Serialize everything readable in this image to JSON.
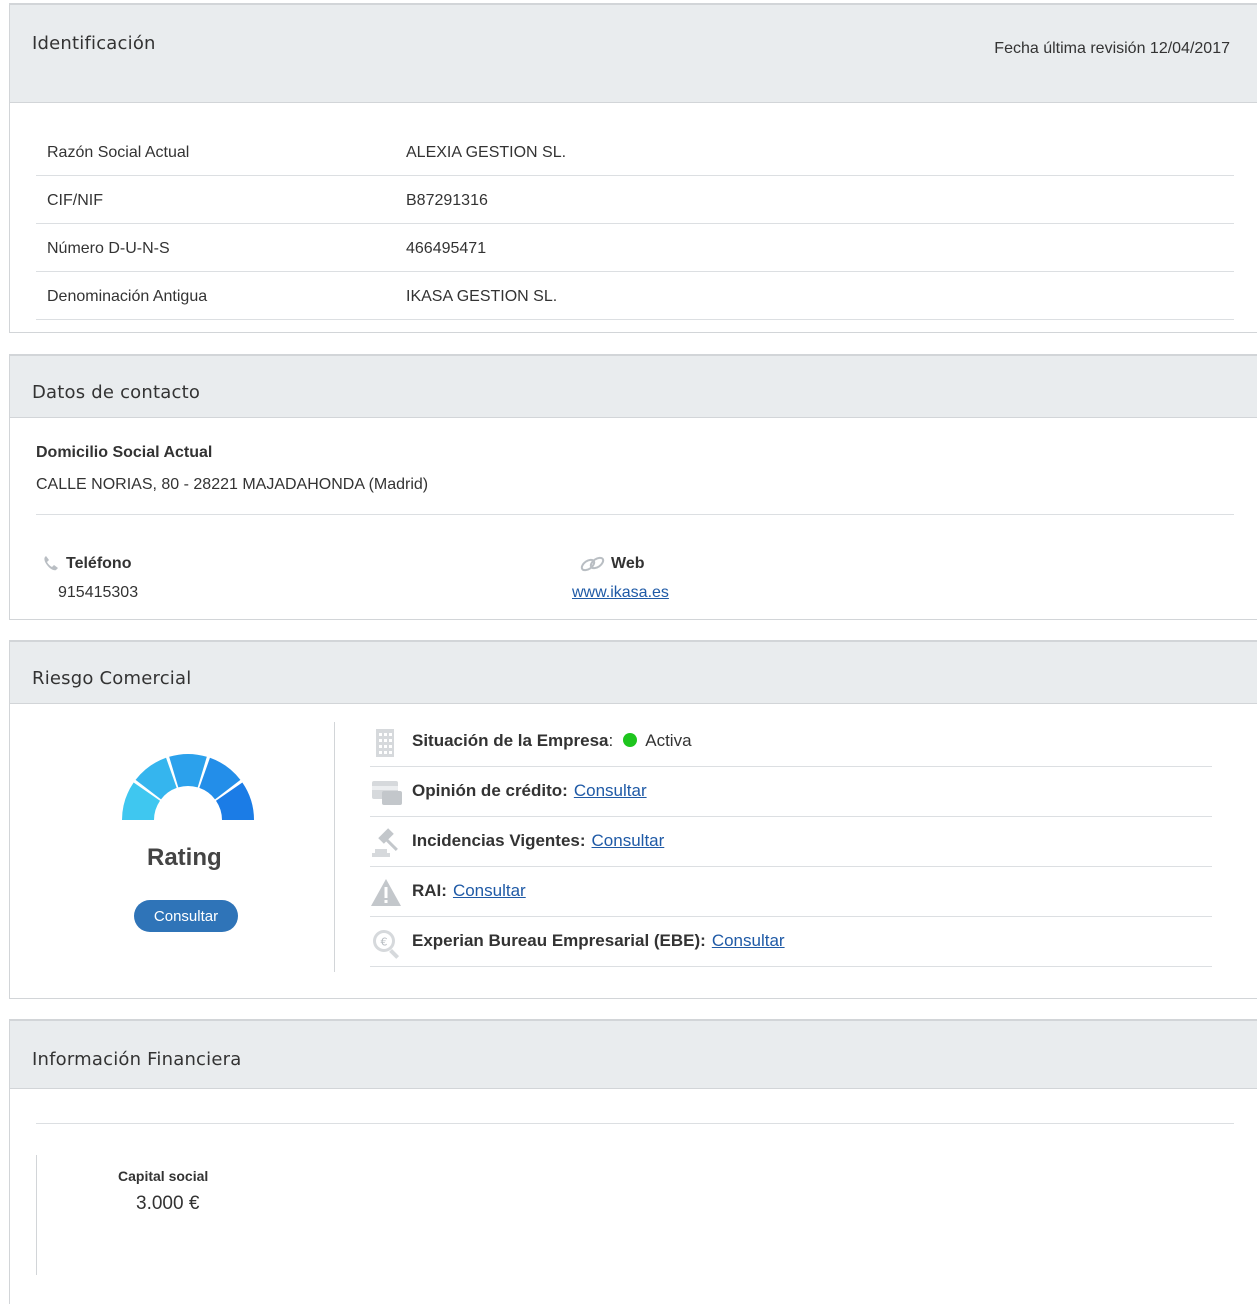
{
  "identificacion": {
    "title": "Identificación",
    "revision": "Fecha última revisión 12/04/2017",
    "rows": [
      {
        "label": "Razón Social Actual",
        "value": "ALEXIA GESTION SL."
      },
      {
        "label": "CIF/NIF",
        "value": "B87291316"
      },
      {
        "label": "Número D-U-N-S",
        "value": "466495471"
      },
      {
        "label": "Denominación Antigua",
        "value": "IKASA GESTION SL."
      }
    ]
  },
  "contacto": {
    "title": "Datos de contacto",
    "domicilio_label": "Domicilio Social Actual",
    "domicilio_value": "CALLE NORIAS, 80 - 28221 MAJADAHONDA (Madrid)",
    "telefono_label": "Teléfono",
    "telefono_value": "915415303",
    "web_label": "Web",
    "web_value": "www.ikasa.es"
  },
  "riesgo": {
    "title": "Riesgo Comercial",
    "rating_label": "Rating",
    "rating_button": "Consultar",
    "gauge_colors": [
      "#3fc7f0",
      "#35b5ee",
      "#2ba1ec",
      "#238ee9",
      "#1b7ce6"
    ],
    "items": [
      {
        "label": "Situación de la Empresa",
        "separator": ":",
        "status": "Activa",
        "status_color": "#1ec51e",
        "icon": "building-icon"
      },
      {
        "label": "Opinión de crédito:",
        "link": "Consultar",
        "icon": "credit-card-icon"
      },
      {
        "label": "Incidencias Vigentes:",
        "link": "Consultar",
        "icon": "gavel-icon"
      },
      {
        "label": "RAI:",
        "link": "Consultar",
        "icon": "warning-icon"
      },
      {
        "label": "Experian Bureau Empresarial (EBE):",
        "link": "Consultar",
        "icon": "euro-magnifier-icon"
      }
    ]
  },
  "financiera": {
    "title": "Información Financiera",
    "capital_label": "Capital social",
    "capital_value": "3.000 €"
  }
}
